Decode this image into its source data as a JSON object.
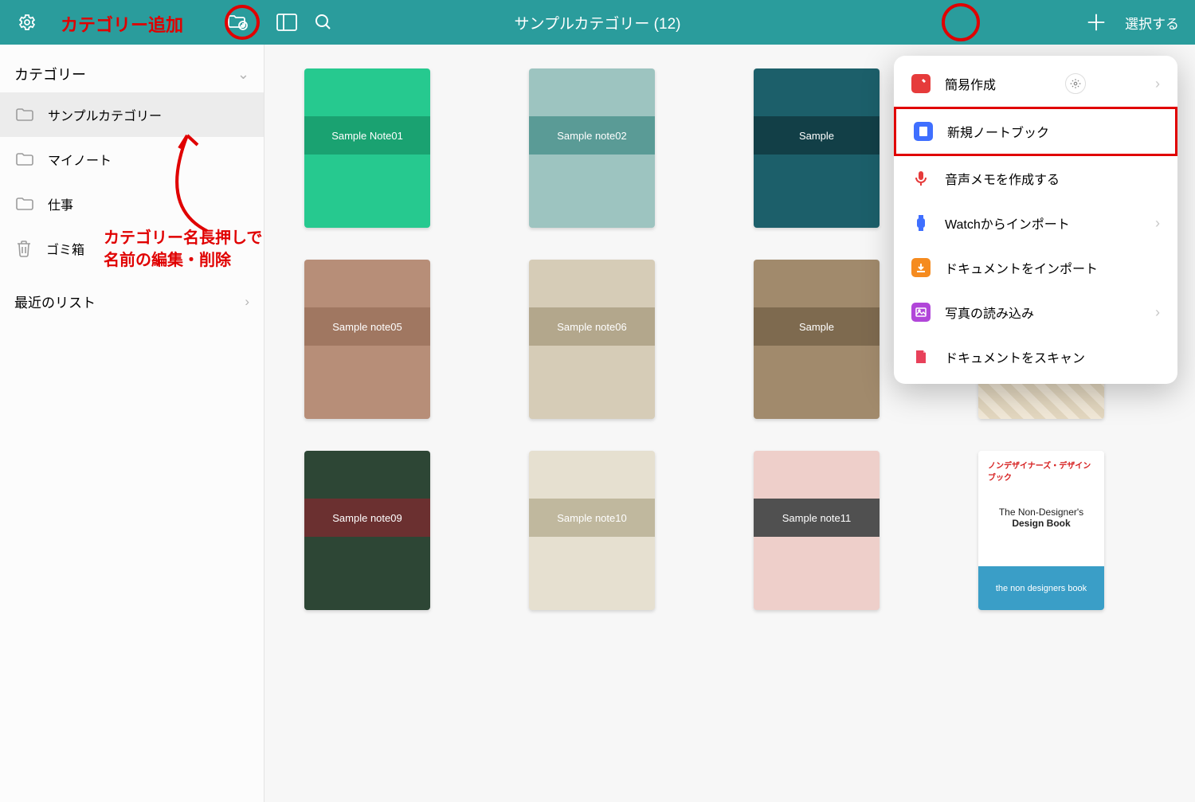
{
  "header": {
    "title": "サンプルカテゴリー (12)",
    "select": "選択する"
  },
  "annotations": {
    "add_category": "カテゴリー追加",
    "longpress_l1": "カテゴリー名長押しで",
    "longpress_l2": "名前の編集・削除"
  },
  "sidebar": {
    "heading": "カテゴリー",
    "items": [
      {
        "label": "サンプルカテゴリー",
        "active": true
      },
      {
        "label": "マイノート",
        "active": false
      },
      {
        "label": "仕事",
        "active": false
      },
      {
        "label": "ゴミ箱",
        "active": false,
        "trash": true
      }
    ],
    "recent": "最近のリスト"
  },
  "notes": {
    "n1": "Sample Note01",
    "n2": "Sample note02",
    "n3": "Sample",
    "n5": "Sample note05",
    "n6": "Sample note06",
    "n7": "Sample",
    "n9": "Sample note09",
    "n10": "Sample note10",
    "n11": "Sample note11",
    "n12_top": "ノンデザイナーズ・デザインブック",
    "n12_mid1": "The Non-Designer's",
    "n12_mid2": "Design Book",
    "n12_bot": "the non designers book"
  },
  "popup": {
    "quick": "簡易作成",
    "notebook": "新規ノートブック",
    "voice": "音声メモを作成する",
    "watch": "Watchからインポート",
    "import": "ドキュメントをインポート",
    "photo": "写真の読み込み",
    "scan": "ドキュメントをスキャン"
  }
}
